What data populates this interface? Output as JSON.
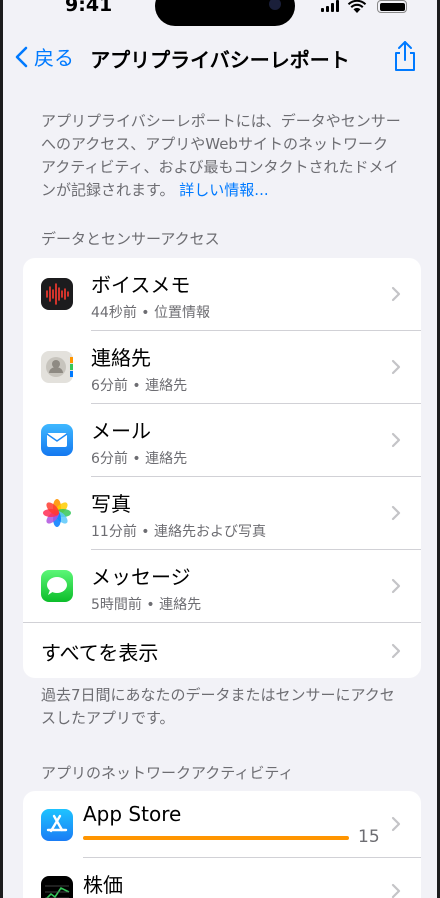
{
  "status_bar": {
    "time": "9:41"
  },
  "nav": {
    "back_label": "戻る",
    "title": "アプリプライバシーレポート"
  },
  "intro": {
    "text": "アプリプライバシーレポートには、データやセンサーへのアクセス、アプリやWebサイトのネットワークアクティビティ、および最もコンタクトされたドメインが記録されます。",
    "link": "詳しい情報..."
  },
  "data_access": {
    "header": "データとセンサーアクセス",
    "items": [
      {
        "name": "ボイスメモ",
        "detail": "44秒前 • 位置情報",
        "icon": "voice-memos-icon"
      },
      {
        "name": "連絡先",
        "detail": "6分前 • 連絡先",
        "icon": "contacts-icon"
      },
      {
        "name": "メール",
        "detail": "6分前 • 連絡先",
        "icon": "mail-icon"
      },
      {
        "name": "写真",
        "detail": "11分前 • 連絡先および写真",
        "icon": "photos-icon"
      },
      {
        "name": "メッセージ",
        "detail": "5時間前 • 連絡先",
        "icon": "messages-icon"
      }
    ],
    "show_all": "すべてを表示",
    "footer": "過去7日間にあなたのデータまたはセンサーにアクセスしたアプリです。"
  },
  "network": {
    "header": "アプリのネットワークアクティビティ",
    "items": [
      {
        "name": "App Store",
        "count": "15",
        "icon": "app-store-icon"
      },
      {
        "name": "株価",
        "icon": "stocks-icon"
      }
    ]
  }
}
